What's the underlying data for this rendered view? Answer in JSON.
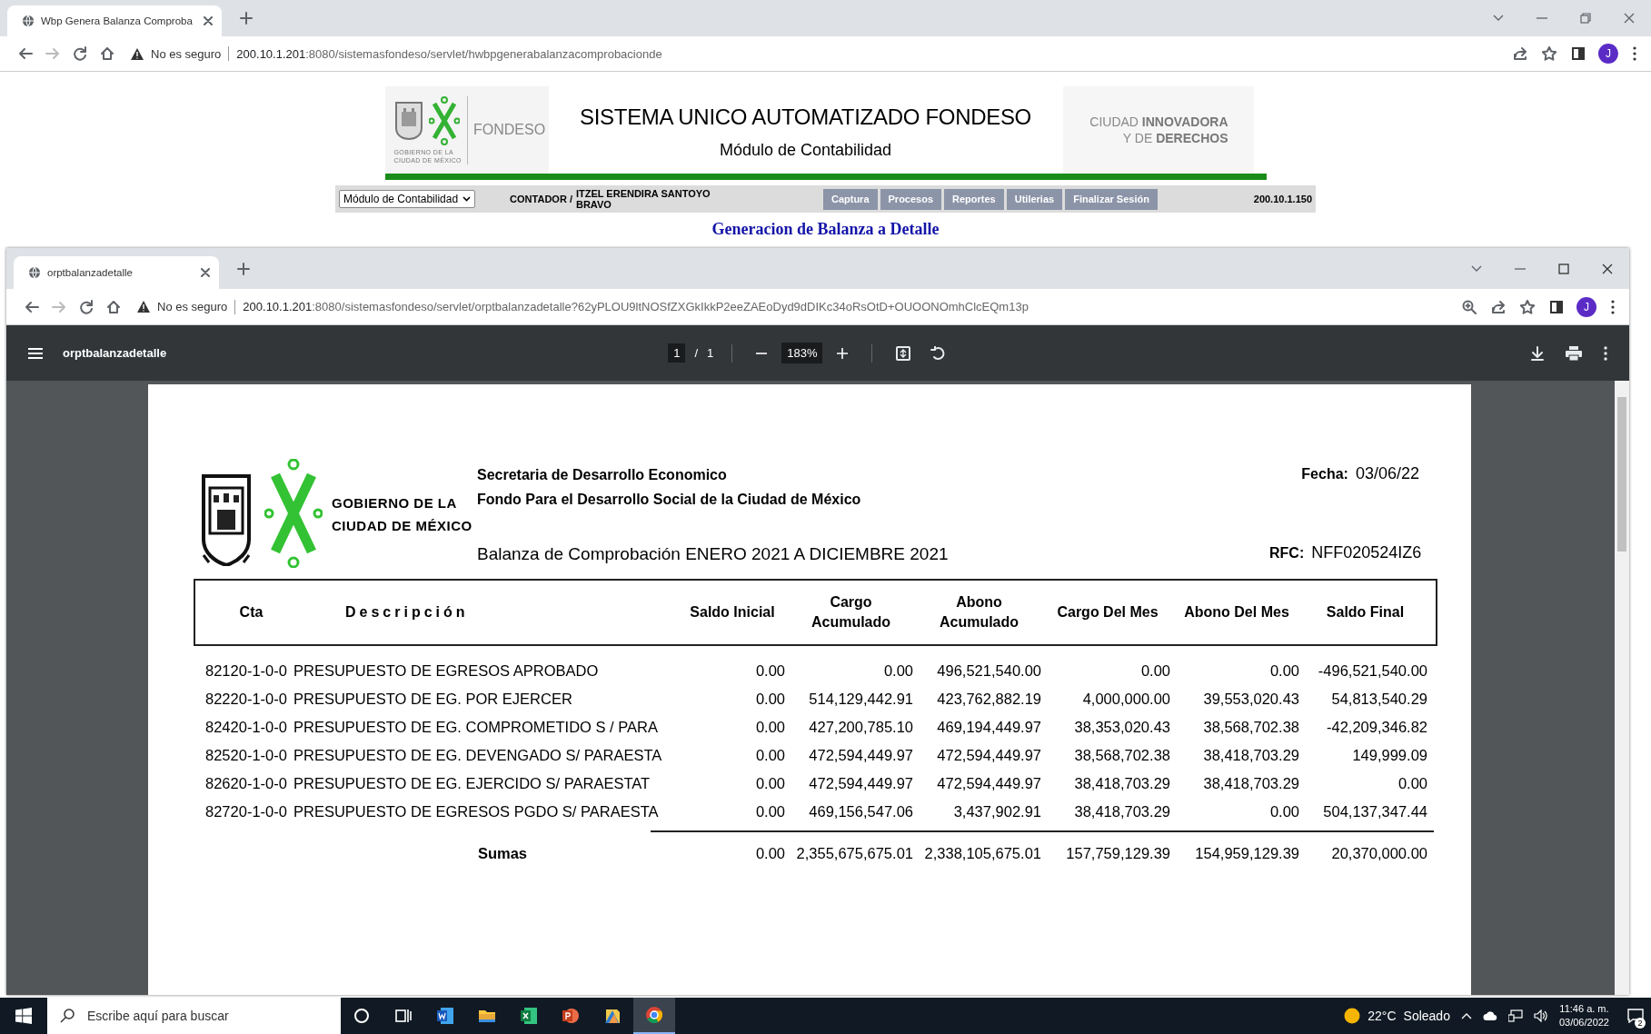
{
  "background_browser": {
    "tab": {
      "title": "Wbp Genera Balanza Comproba"
    },
    "address": {
      "security": "No es seguro",
      "host": "200.10.1.201",
      "path": ":8080/sistemasfondeso/servlet/hwbpgenerabalanzacomprobacionde"
    },
    "profile_initial": "J"
  },
  "app_header": {
    "logo_text": [
      "GOBIERNO DE LA",
      "CIUDAD DE MÉXICO"
    ],
    "agency": "FONDESO",
    "title": "SISTEMA UNICO AUTOMATIZADO FONDESO",
    "subtitle": "Módulo de Contabilidad",
    "slogan": [
      "CIUDAD **INNOVADORA**",
      "Y DE **DERECHOS**"
    ]
  },
  "nav_bar": {
    "module_select": "Módulo de Contabilidad",
    "role": "CONTADOR /",
    "user": "ITZEL ERENDIRA SANTOYO BRAVO",
    "menu": [
      "Captura",
      "Procesos",
      "Reportes",
      "Utilerias",
      "Finalizar Sesión"
    ],
    "ip": "200.10.1.150"
  },
  "page_title": "Generacion de Balanza a Detalle",
  "pdf_window": {
    "tab": {
      "title": "orptbalanzadetalle"
    },
    "address": {
      "security": "No es seguro",
      "host": "200.10.1.201",
      "path": ":8080/sistemasfondeso/servlet/orptbalanzadetalle?62yPLOU9ltNOSfZXGkIkkP2eeZAEoDyd9dDIKc34oRsOtD+OUOONOmhClcEQm13p"
    },
    "profile_initial": "J",
    "viewer": {
      "title": "orptbalanzadetalle",
      "page": "1",
      "page_separator": "/",
      "page_count": "1",
      "zoom": "183%"
    }
  },
  "document": {
    "logo_text": [
      "GOBIERNO DE LA",
      "CIUDAD DE MÉXICO"
    ],
    "organization": [
      "Secretaria de Desarrollo Economico",
      "Fondo Para el Desarrollo Social de la Ciudad de México"
    ],
    "date_label": "Fecha:",
    "date": "03/06/22",
    "title": "Balanza de Comprobación ENERO 2021 A DICIEMBRE 2021",
    "rfc_label": "RFC:",
    "rfc": "NFF020524IZ6",
    "columns": [
      "Cta",
      "Descripción",
      "Saldo Inicial",
      "Cargo Acumulado",
      "Abono Acumulado",
      "Cargo Del Mes",
      "Abono Del Mes",
      "Saldo Final"
    ],
    "rows": [
      {
        "cta": "82120-1-0-0",
        "description": "PRESUPUESTO DE EGRESOS APROBADO",
        "values": [
          "0.00",
          "0.00",
          "496,521,540.00",
          "0.00",
          "0.00",
          "-496,521,540.00"
        ]
      },
      {
        "cta": "82220-1-0-0",
        "description": "PRESUPUESTO DE EG. POR EJERCER",
        "values": [
          "0.00",
          "514,129,442.91",
          "423,762,882.19",
          "4,000,000.00",
          "39,553,020.43",
          "54,813,540.29"
        ]
      },
      {
        "cta": "82420-1-0-0",
        "description": "PRESUPUESTO DE EG. COMPROMETIDO S / PARA",
        "values": [
          "0.00",
          "427,200,785.10",
          "469,194,449.97",
          "38,353,020.43",
          "38,568,702.38",
          "-42,209,346.82"
        ]
      },
      {
        "cta": "82520-1-0-0",
        "description": "PRESUPUESTO DE EG. DEVENGADO S/ PARAESTA",
        "values": [
          "0.00",
          "472,594,449.97",
          "472,594,449.97",
          "38,568,702.38",
          "38,418,703.29",
          "149,999.09"
        ]
      },
      {
        "cta": "82620-1-0-0",
        "description": "PRESUPUESTO DE EG. EJERCIDO S/ PARAESTAT",
        "values": [
          "0.00",
          "472,594,449.97",
          "472,594,449.97",
          "38,418,703.29",
          "38,418,703.29",
          "0.00"
        ]
      },
      {
        "cta": "82720-1-0-0",
        "description": "PRESUPUESTO DE EGRESOS PGDO S/ PARAESTA",
        "values": [
          "0.00",
          "469,156,547.06",
          "3,437,902.91",
          "38,418,703.29",
          "0.00",
          "504,137,347.44"
        ]
      }
    ],
    "totals": {
      "label": "Sumas",
      "values": [
        "0.00",
        "2,355,675,675.01",
        "2,338,105,675.01",
        "157,759,129.39",
        "154,959,129.39",
        "20,370,000.00"
      ]
    }
  },
  "taskbar": {
    "search_placeholder": "Escribe aquí para buscar",
    "apps": [
      {
        "kind": "circle",
        "selected": false
      },
      {
        "kind": "taskview",
        "selected": false
      },
      {
        "kind": "document",
        "selected": false
      },
      {
        "kind": "folder",
        "selected": false
      },
      {
        "kind": "spreadsheet",
        "selected": false
      },
      {
        "kind": "slides",
        "selected": false
      },
      {
        "kind": "files",
        "selected": false
      },
      {
        "kind": "browser",
        "selected": true
      }
    ],
    "temperature": "22°C",
    "weather": "Soleado",
    "time": "11:46 a. m.",
    "date": "03/06/2022",
    "notifications": "2"
  }
}
